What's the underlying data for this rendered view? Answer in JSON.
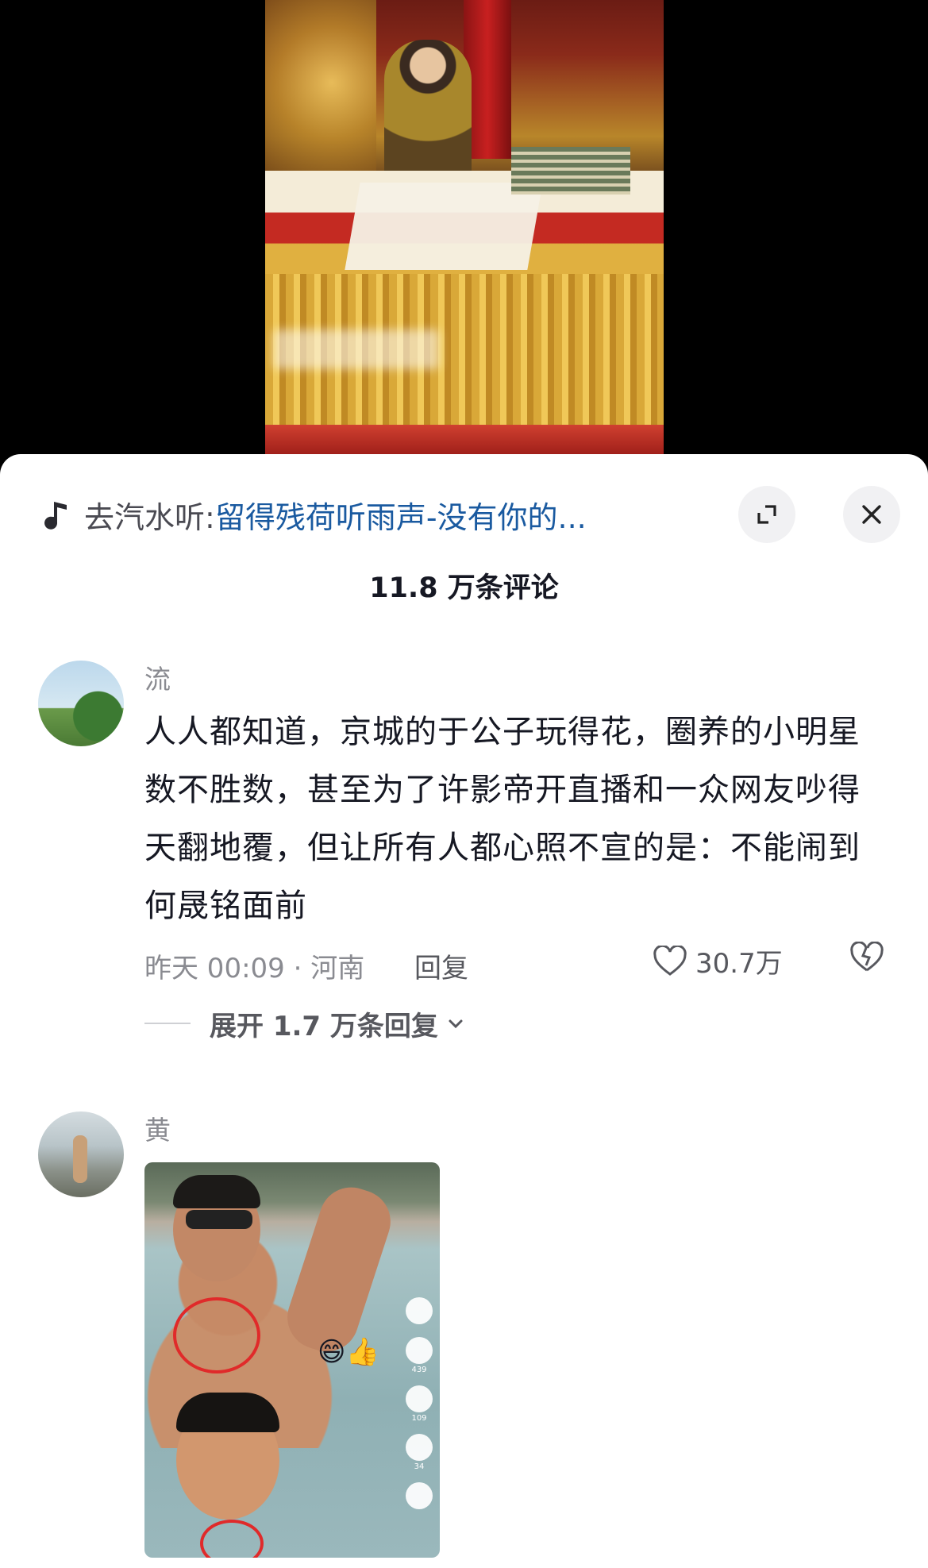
{
  "music": {
    "prefix": "去汽水听:",
    "title": "留得残荷听雨声-没有你的..."
  },
  "comments_header": {
    "count_text": "11.8 万条评论"
  },
  "comments": [
    {
      "username": "流",
      "text": "人人都知道，京城的于公子玩得花，圈养的小明星数不胜数，甚至为了许影帝开直播和一众网友吵得天翻地覆，但让所有人都心照不宣的是：不能闹到何晟铭面前",
      "time_location": "昨天 00:09 · 河南",
      "reply_label": "回复",
      "likes": "30.7万",
      "expand_label": "展开 1.7 万条回复"
    },
    {
      "username": "黄",
      "photo_stats": {
        "likes": "439",
        "comments": "109",
        "favorites": "34"
      }
    }
  ],
  "colors": {
    "link_blue": "#1a5aa0",
    "text_primary": "#161823",
    "text_secondary": "#8a8b91"
  },
  "icons": [
    "music-note-icon",
    "expand-icon",
    "close-icon",
    "heart-icon",
    "broken-heart-icon",
    "chevron-down-icon"
  ]
}
